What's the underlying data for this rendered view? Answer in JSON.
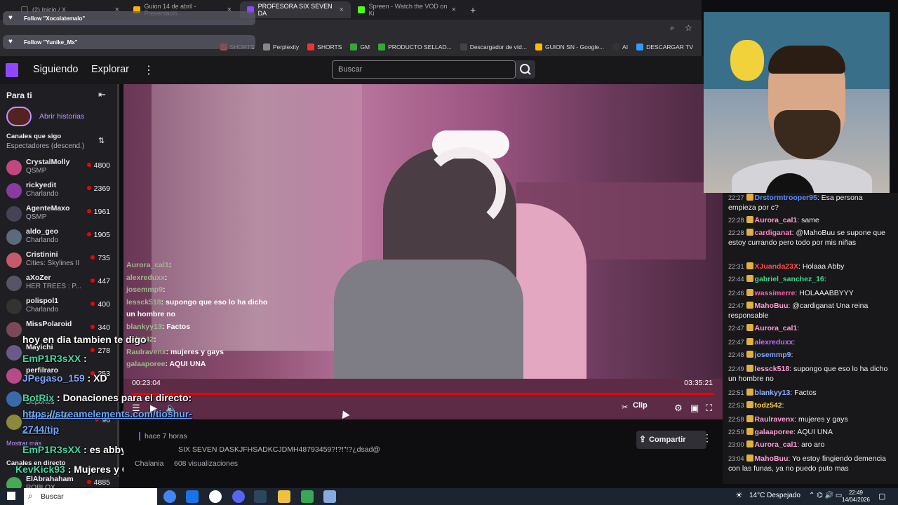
{
  "browser": {
    "tabs": [
      {
        "label": "(2) Inicio / X",
        "color": "#222"
      },
      {
        "label": "Guion 14 de abril - Presentació",
        "color": "#f4b400"
      },
      {
        "label": "PROFESORA SIX SEVEN DA",
        "color": "#9147ff"
      },
      {
        "label": "Spreen - Watch the VOD on Ki",
        "color": "#53fc18"
      }
    ],
    "new_tab": "+",
    "notifications": [
      "Follow \"Xocolatemalo\"",
      "Follow \"Yunike_Mx\""
    ],
    "bookmarks": [
      "SHORTS",
      "Perplexity",
      "SHORTS",
      "GM",
      "PRODUCTO SELLAD...",
      "Descargador de víd...",
      "GUION SN - Google...",
      "AI",
      "DESCARGAR TV"
    ]
  },
  "twitch": {
    "nav": {
      "following": "Siguiendo",
      "browse": "Explorar",
      "search_placeholder": "Buscar"
    },
    "sidebar": {
      "title": "Para ti",
      "stories": "Abrir historias",
      "followed_title": "Canales que sigo",
      "followed_sort": "Espectadores (descend.)",
      "channels": [
        {
          "name": "CrystalMolly",
          "game": "QSMP",
          "viewers": "4800",
          "color": "#c2477e"
        },
        {
          "name": "rickyedit",
          "game": "Charlando",
          "viewers": "2369",
          "color": "#8a3ba0"
        },
        {
          "name": "AgenteMaxo",
          "game": "QSMP",
          "viewers": "1961",
          "color": "#445"
        },
        {
          "name": "aldo_geo",
          "game": "Charlando",
          "viewers": "1905",
          "color": "#5a6b7c"
        },
        {
          "name": "Cristinini",
          "game": "Cities: Skylines II",
          "viewers": "735",
          "color": "#c55a6a"
        },
        {
          "name": "aXoZer",
          "game": "HER TREES : P...",
          "viewers": "447",
          "color": "#556"
        },
        {
          "name": "polispol1",
          "game": "Charlando",
          "viewers": "400",
          "color": "#333"
        },
        {
          "name": "MissPolaroid",
          "game": "",
          "viewers": "340",
          "color": "#7a4a5a"
        },
        {
          "name": "Mayichi",
          "game": "",
          "viewers": "278",
          "color": "#6a5a8a"
        },
        {
          "name": "perfilraro",
          "game": "",
          "viewers": "253",
          "color": "#b84a8a"
        },
        {
          "name": "",
          "game": "Deportes",
          "viewers": "",
          "color": "#3a6aa8"
        },
        {
          "name": "Cursedwind",
          "game": "",
          "viewers": "96",
          "color": "#8a8a3a"
        }
      ],
      "show_more": "Mostrar más",
      "live_title": "Canales en directo",
      "last_channel": {
        "name": "ElAbrahaham",
        "game": "ROBLOX",
        "viewers": "4885"
      }
    },
    "video": {
      "current_time": "00:23:04",
      "duration": "03:35:21",
      "progress": 1.0,
      "clip_label": "Clip",
      "overlay_chat": [
        {
          "user": "Aurora_cal1",
          "text": ":"
        },
        {
          "user": "alexreduxx",
          "text": ":"
        },
        {
          "user": "josemmp9",
          "text": ":"
        },
        {
          "user": "lessck518",
          "text": ": supongo que eso lo ha dicho"
        },
        {
          "user": "",
          "text": "un hombre no"
        },
        {
          "user": "blankyy13",
          "text": ": Factos"
        },
        {
          "user": "todz542",
          "text": ":"
        },
        {
          "user": "Raulravenx",
          "text": ": mujeres y gays"
        },
        {
          "user": "galaaporee",
          "text": ": AQUI UNA"
        }
      ]
    },
    "stream_overlay": [
      {
        "user": "",
        "text": "hoy en dia tambien te digo"
      },
      {
        "user": "EmP1R3sXX",
        "text": " :"
      },
      {
        "user": "JPegaso_159",
        "text": " : XD"
      },
      {
        "user": "BotRix",
        "text": " : Donaciones para el directo:"
      },
      {
        "user": "",
        "text": "https://streamelements.com/tioshur-"
      },
      {
        "user": "",
        "text": "2744/tip"
      },
      {
        "user": "EmP1R3sXX",
        "text": " : es abby? xd"
      },
      {
        "user": "KevKick93",
        "text": " : Mujeres y Guibel"
      }
    ],
    "info": {
      "ago": "hace 7 horas",
      "title": "SIX SEVEN DASKJFHSADKCJDMH48793459?!?!\"!?¿dsad@",
      "channel": "Chalania",
      "views": "608 visualizaciones",
      "share": "Compartir"
    },
    "chat": [
      {
        "time": "22:27",
        "user": "Drstormtrooper95",
        "color": "#5b8cff",
        "text": ": Esa persona empieza por c?"
      },
      {
        "time": "22:28",
        "user": "Aurora_cal1",
        "color": "#ff9bd2",
        "text": ": same"
      },
      {
        "time": "22:28",
        "user": "cardiganat",
        "color": "#ff7fbf",
        "text": ": @MahoBuu se supone que estoy currando pero todo por mis niñas"
      },
      {
        "time": "22:31",
        "user": "XJuanda23X",
        "color": "#ff4b4b",
        "text": ": Holaaa Abby"
      },
      {
        "time": "22:44",
        "user": "gabriel_sanchez_16",
        "color": "#3fd68f",
        "text": ":"
      },
      {
        "time": "22:46",
        "user": "wassimerre",
        "color": "#ff5aa8",
        "text": ": HOLAAABBYYY"
      },
      {
        "time": "22:47",
        "user": "MahoBuu",
        "color": "#ff9bd2",
        "text": ": @cardiganat Una reina responsable"
      },
      {
        "time": "22:47",
        "user": "Aurora_cal1",
        "color": "#ff9bd2",
        "text": ":"
      },
      {
        "time": "22:47",
        "user": "alexreduxx",
        "color": "#bf6bff",
        "text": ":"
      },
      {
        "time": "22:48",
        "user": "josemmp9",
        "color": "#7fa8ff",
        "text": ":"
      },
      {
        "time": "22:49",
        "user": "lessck518",
        "color": "#ff9bd2",
        "text": ": supongo que eso lo ha dicho un hombre no"
      },
      {
        "time": "22:51",
        "user": "blankyy13",
        "color": "#8fb0ff",
        "text": ": Factos"
      },
      {
        "time": "22:53",
        "user": "todz542",
        "color": "#ffd24a",
        "text": ":"
      },
      {
        "time": "22:58",
        "user": "Raulravenx",
        "color": "#ff9bd2",
        "text": ": mujeres y gays"
      },
      {
        "time": "22:59",
        "user": "galaaporee",
        "color": "#ff9bd2",
        "text": ": AQUI UNA"
      },
      {
        "time": "23:00",
        "user": "Aurora_cal1",
        "color": "#ff9bd2",
        "text": ": aro aro"
      },
      {
        "time": "23:04",
        "user": "MahoBuu",
        "color": "#ff9bd2",
        "text": ": Yo estoy fingiendo demencia con las funas, ya no puedo puto mas"
      }
    ]
  },
  "taskbar": {
    "search": "Buscar",
    "weather": "14°C  Despejado",
    "time": "22:49",
    "date": "14/04/2026"
  },
  "colors": {
    "accent": "#9147ff",
    "live": "#eb0400"
  }
}
